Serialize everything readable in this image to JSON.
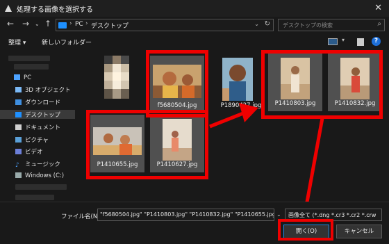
{
  "window": {
    "title": "処理する画像を選択する"
  },
  "nav": {
    "path": [
      "PC",
      "デスクトップ"
    ],
    "search_placeholder": "デスクトップの検索"
  },
  "toolbar": {
    "organize": "整理 ▾",
    "new_folder": "新しいフォルダー"
  },
  "sidebar": {
    "items": [
      {
        "label": "PC",
        "icon": "pc-icon"
      },
      {
        "label": "3D オブジェクト",
        "icon": "3d-objects-icon"
      },
      {
        "label": "ダウンロード",
        "icon": "download-icon"
      },
      {
        "label": "デスクトップ",
        "icon": "desktop-icon"
      },
      {
        "label": "ドキュメント",
        "icon": "documents-icon"
      },
      {
        "label": "ピクチャ",
        "icon": "pictures-icon"
      },
      {
        "label": "ビデオ",
        "icon": "videos-icon"
      },
      {
        "label": "ミュージック",
        "icon": "music-icon"
      },
      {
        "label": "Windows (C:)",
        "icon": "drive-icon"
      }
    ]
  },
  "files": [
    {
      "name": "f5680504.jpg"
    },
    {
      "name": "P1890427.jpg"
    },
    {
      "name": "P1410803.jpg"
    },
    {
      "name": "P1410832.jpg"
    },
    {
      "name": "P1410655.jpg"
    },
    {
      "name": "P1410627.jpg"
    }
  ],
  "bottom": {
    "filename_label": "ファイル名(N):",
    "filename_value": "\"f5680504.jpg\" \"P1410803.jpg\" \"P1410832.jpg\" \"P1410655.jpg\"",
    "filetype_value": "画像全て (*.dng *.cr3 *.cr2 *.crw",
    "open_label": "開く(O)",
    "cancel_label": "キャンセル"
  },
  "colors": {
    "highlight": "#ef0000",
    "accent": "#1e88e5"
  }
}
